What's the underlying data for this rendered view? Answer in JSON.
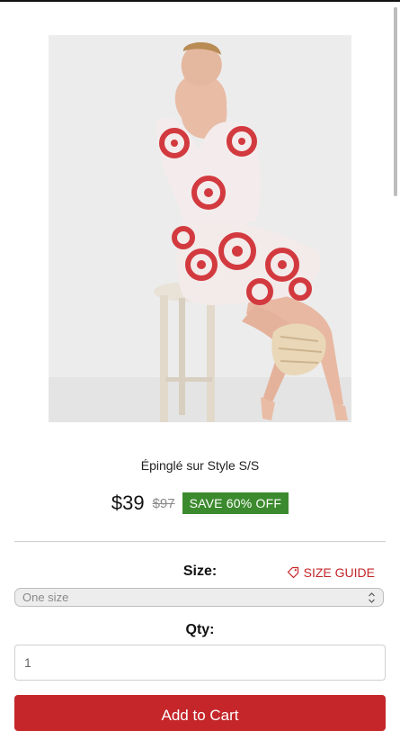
{
  "product": {
    "title": "Épinglé sur Style S/S",
    "price": "$39",
    "old_price": "$97",
    "save_badge": "SAVE 60% OFF",
    "image_alt": "Model wearing red and white embroidered dress"
  },
  "options": {
    "size_label": "Size:",
    "size_guide_label": "SIZE GUIDE",
    "size_value": "One size",
    "qty_label": "Qty:",
    "qty_value": "1"
  },
  "cart": {
    "button_label": "Add to Cart"
  },
  "colors": {
    "accent_red": "#c4262a",
    "save_green": "#3c8a2e"
  }
}
